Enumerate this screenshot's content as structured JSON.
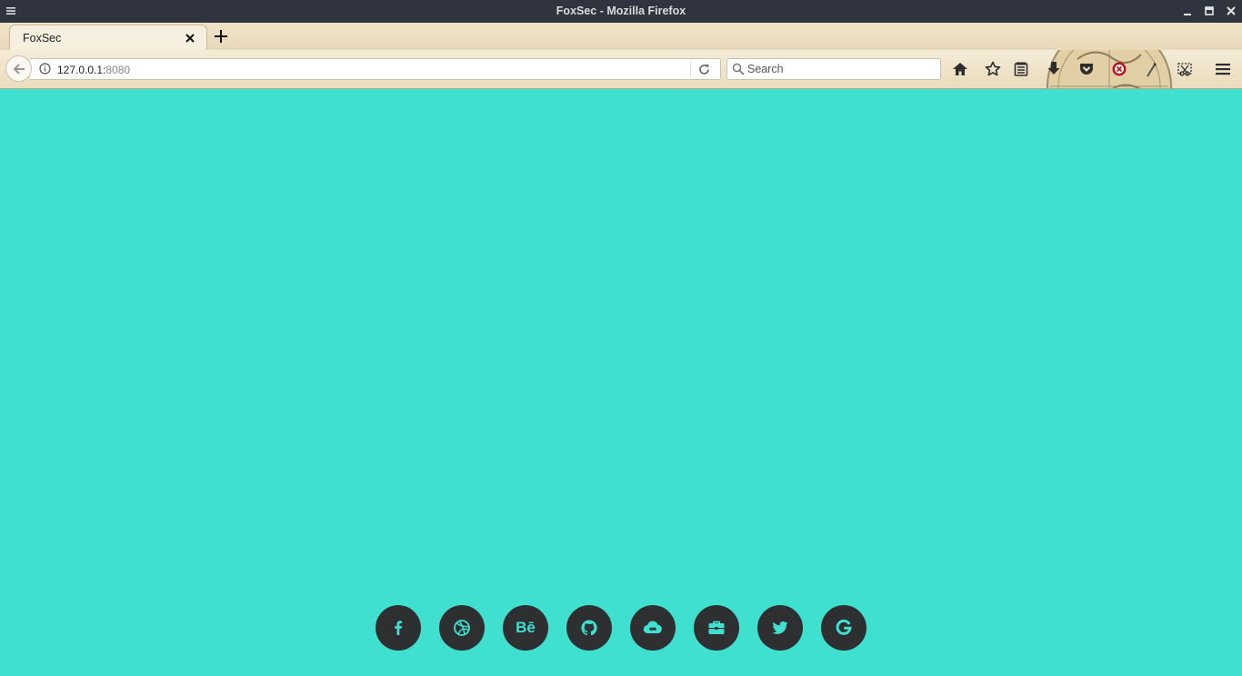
{
  "window": {
    "title": "FoxSec - Mozilla Firefox"
  },
  "tabs": [
    {
      "label": "FoxSec",
      "active": true
    }
  ],
  "navbar": {
    "url_host": "127.0.0.1:",
    "url_port": "8080",
    "search_placeholder": "Search"
  },
  "toolbar_icons": [
    "home-icon",
    "bookmark-star-icon",
    "reading-list-icon",
    "download-icon",
    "pocket-icon",
    "ublock-icon",
    "wand-icon",
    "screenshot-icon",
    "hamburger-menu-icon"
  ],
  "page": {
    "background_color": "#40e0d0",
    "button_color": "#2d2f30",
    "social_links": [
      {
        "name": "facebook",
        "icon": "facebook-icon"
      },
      {
        "name": "dribbble",
        "icon": "dribbble-icon"
      },
      {
        "name": "behance",
        "icon": "behance-icon",
        "text": "Bē"
      },
      {
        "name": "github",
        "icon": "github-icon"
      },
      {
        "name": "cloud",
        "icon": "cloud-icon"
      },
      {
        "name": "portfolio",
        "icon": "briefcase-icon"
      },
      {
        "name": "twitter",
        "icon": "twitter-icon"
      },
      {
        "name": "google",
        "icon": "google-icon"
      }
    ]
  }
}
